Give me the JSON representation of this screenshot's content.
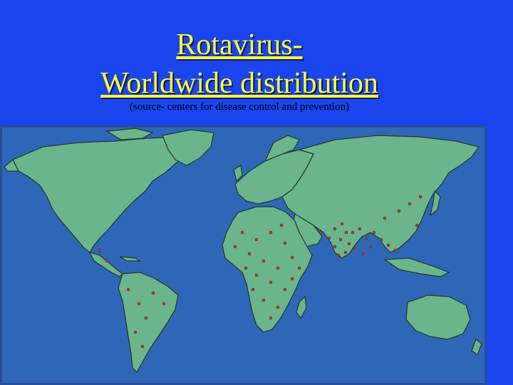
{
  "slide": {
    "title_line1": "Rotavirus-",
    "title_line2": "Worldwide distribution",
    "source": "(source- centers for disease control and prevention)"
  },
  "map": {
    "ocean_color": "#2e67b8",
    "land_color": "#6bb58c",
    "border_color": "#1b3a2a",
    "case_dot_color": "#c0392b"
  }
}
